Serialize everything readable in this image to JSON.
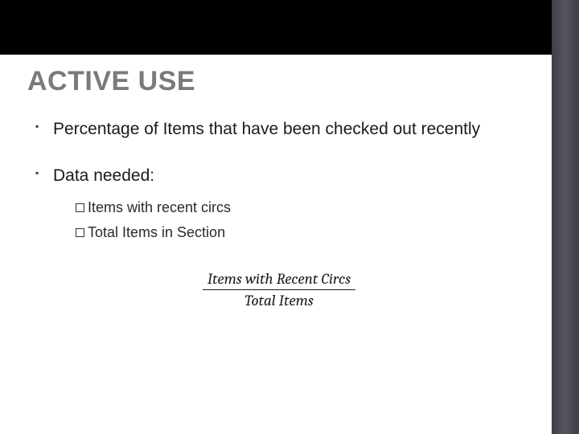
{
  "title": "ACTIVE USE",
  "bullets": [
    {
      "text": "Percentage of Items that have been checked out recently"
    },
    {
      "text": "Data needed:",
      "sub": [
        {
          "text": "Items with recent circs"
        },
        {
          "text": "Total Items in Section"
        }
      ]
    }
  ],
  "formula": {
    "numerator": "Items with Recent Circs",
    "denominator": "Total Items"
  }
}
